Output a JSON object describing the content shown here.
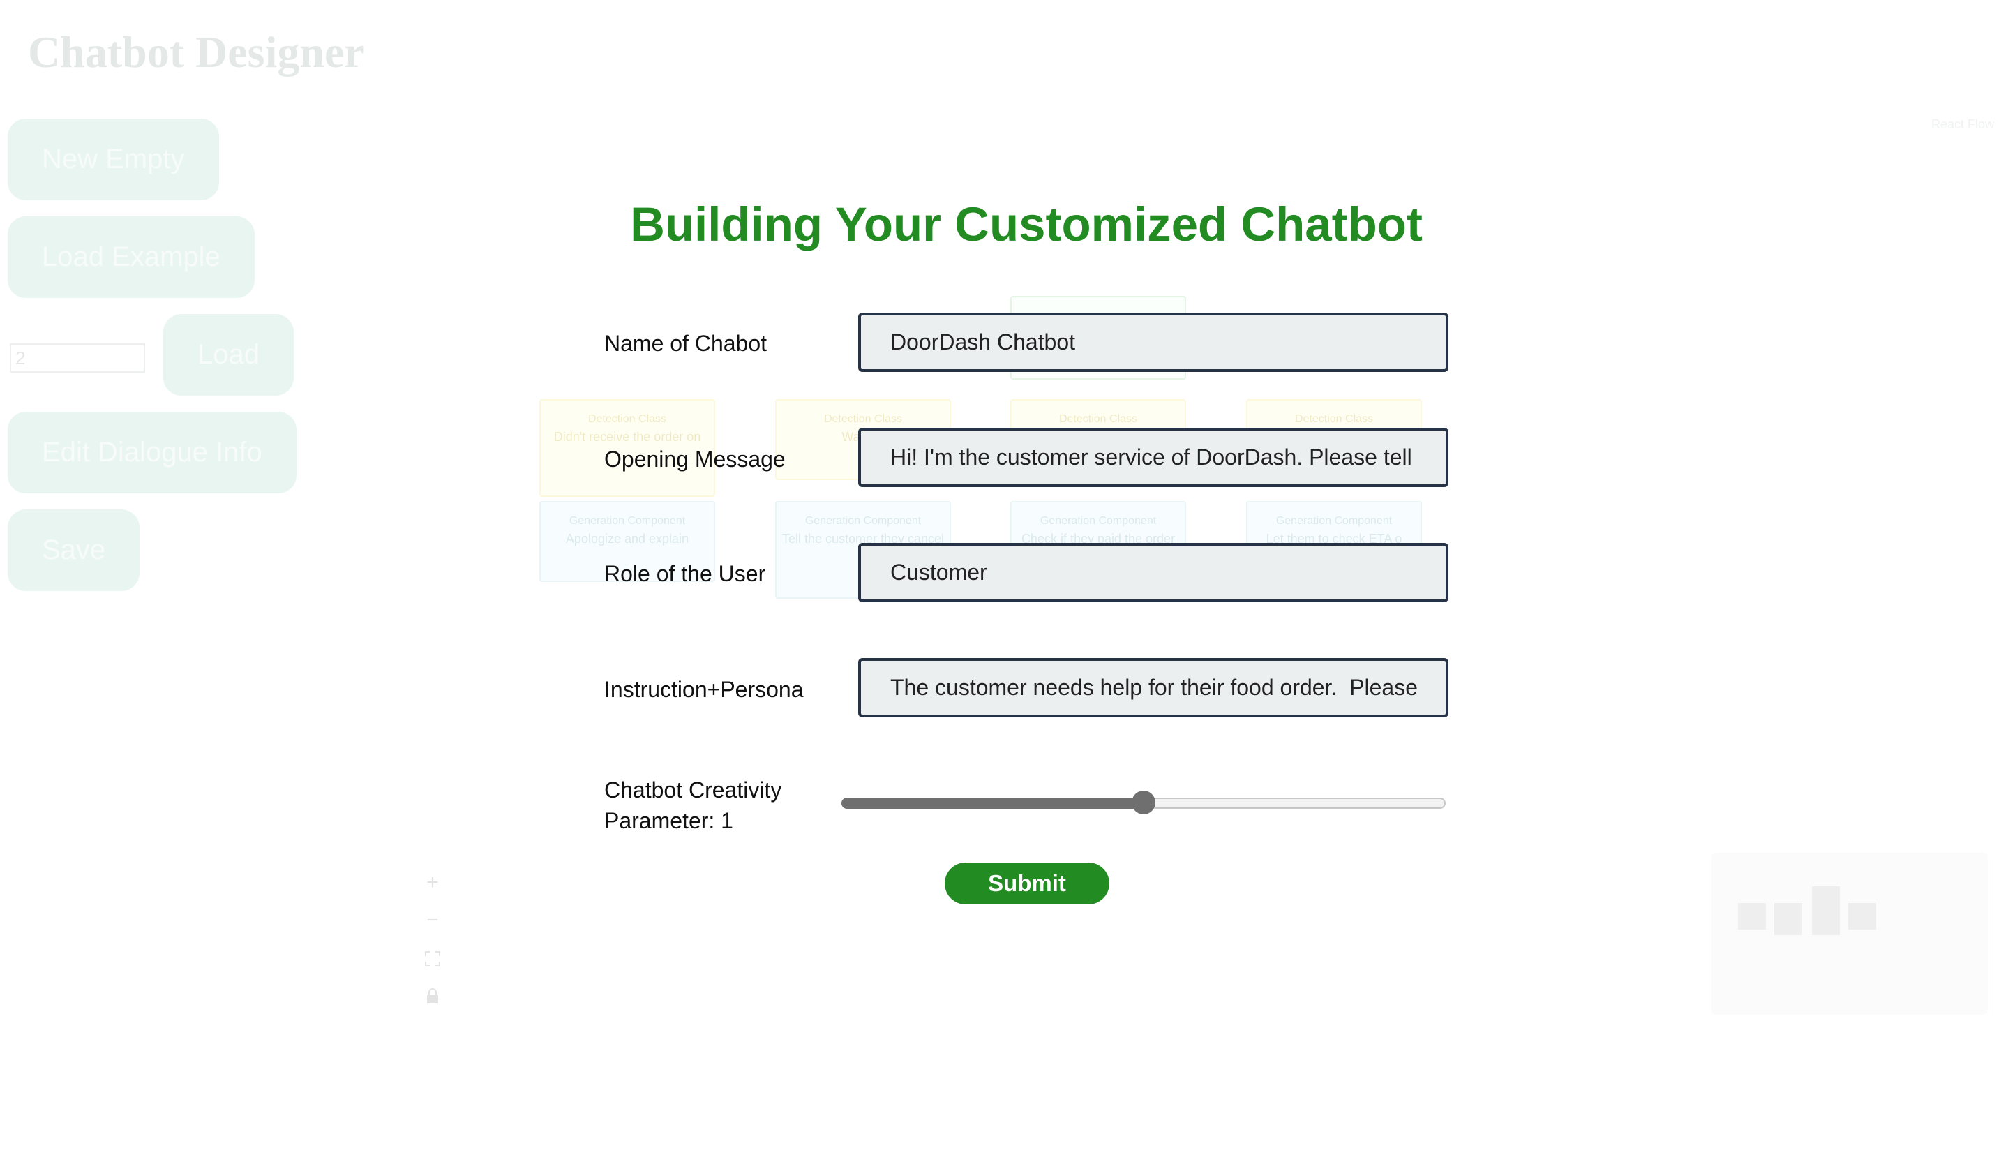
{
  "app": {
    "title": "Chatbot Designer",
    "attribution": "React Flow"
  },
  "sidebar": {
    "new_empty": "New Empty",
    "load_example": "Load Example",
    "example_number": "2",
    "load": "Load",
    "edit_dialogue_info": "Edit Dialogue Info",
    "save": "Save"
  },
  "canvas": {
    "nodes": [
      {
        "type": "Detection Class",
        "text": "Didn't receive the order on"
      },
      {
        "type": "Detection Class",
        "text": "Want to"
      },
      {
        "type": "Detection Class",
        "text": ""
      },
      {
        "type": "Detection Class",
        "text": ""
      },
      {
        "type": "Generation Component",
        "text": "Apologize and explain"
      },
      {
        "type": "Generation Component",
        "text": "Tell the customer they cancel"
      },
      {
        "type": "Generation Component",
        "text": "Check if they paid the order"
      },
      {
        "type": "Generation Component",
        "text": "Let them to check ETA o"
      }
    ],
    "controls": [
      "plus-icon",
      "minus-icon",
      "fit-view-icon",
      "lock-icon"
    ]
  },
  "form": {
    "title": "Building Your Customized Chatbot",
    "chatbot_name_label": "Name of Chabot",
    "chatbot_name_value": "DoorDash Chatbot",
    "opening_label": "Opening Message",
    "opening_value": "Hi! I'm the customer service of DoorDash. Please tell",
    "role_label": "Role of the User",
    "role_value": "Customer",
    "instruction_label": "Instruction+Persona",
    "instruction_value": "The customer needs help for their food order.  Please",
    "creativity_label_line1": "Chatbot Creativity",
    "creativity_label_line2": "Parameter: 1",
    "creativity_fraction": 0.5,
    "submit_label": "Submit"
  },
  "colors": {
    "accent": "#228b22",
    "input_border": "#263245",
    "input_bg": "#ebeff0"
  }
}
